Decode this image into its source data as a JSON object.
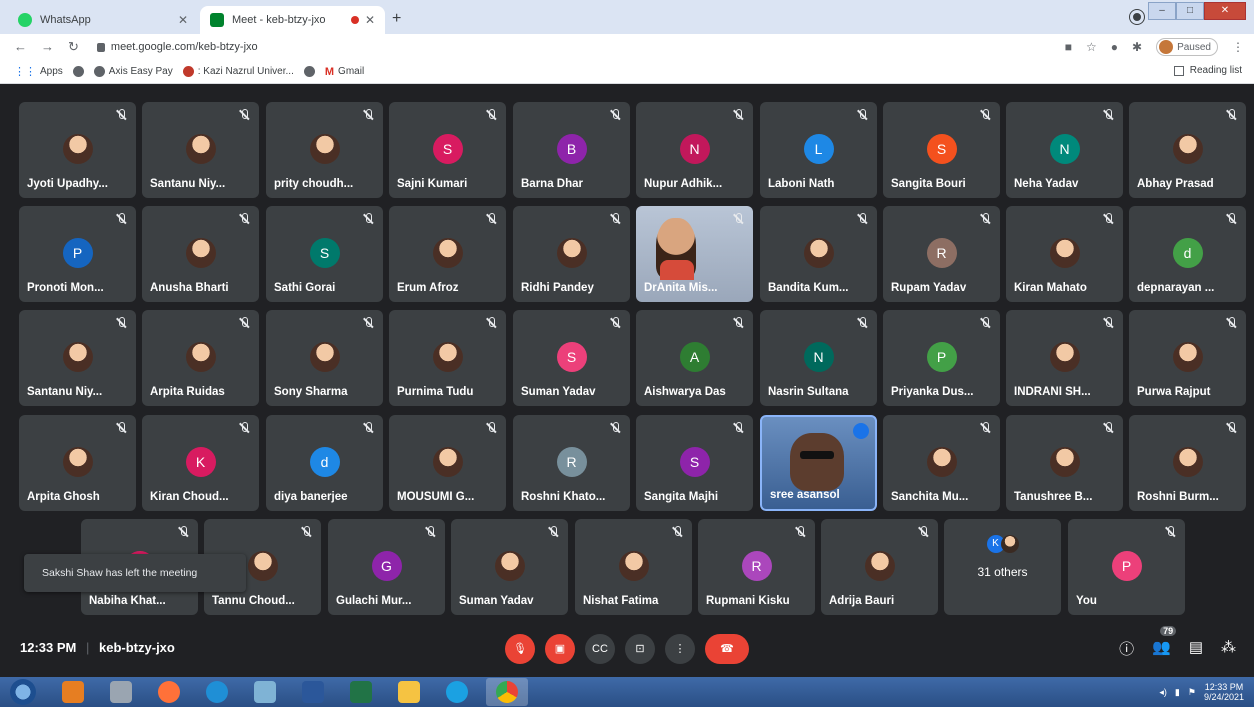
{
  "browser": {
    "tabs": [
      {
        "title": "WhatsApp",
        "favicon_color": "#25d366"
      },
      {
        "title": "Meet - keb-btzy-jxo",
        "favicon_color": "#00832d"
      }
    ],
    "url": "meet.google.com/keb-btzy-jxo",
    "profile_status": "Paused",
    "bookmarks": [
      {
        "label": "Apps"
      },
      {
        "label": "Axis Easy Pay"
      },
      {
        "label": ": Kazi Nazrul Univer..."
      },
      {
        "label": "Gmail"
      }
    ],
    "reading_list": "Reading list"
  },
  "meeting": {
    "toast": "Sakshi Shaw has left the meeting",
    "participants": [
      {
        "name": "Jyoti Upadhy...",
        "initial": "",
        "color": "",
        "kind": "photo"
      },
      {
        "name": "Santanu Niy...",
        "initial": "",
        "color": "",
        "kind": "photo"
      },
      {
        "name": "prity choudh...",
        "initial": "",
        "color": "",
        "kind": "photo"
      },
      {
        "name": "Sajni Kumari",
        "initial": "S",
        "color": "#d81b60",
        "kind": "letter"
      },
      {
        "name": "Barna Dhar",
        "initial": "B",
        "color": "#8e24aa",
        "kind": "letter"
      },
      {
        "name": "Nupur Adhik...",
        "initial": "N",
        "color": "#c2185b",
        "kind": "letter"
      },
      {
        "name": "Laboni Nath",
        "initial": "L",
        "color": "#1e88e5",
        "kind": "letter"
      },
      {
        "name": "Sangita Bouri",
        "initial": "S",
        "color": "#f4511e",
        "kind": "letter"
      },
      {
        "name": "Neha Yadav",
        "initial": "N",
        "color": "#00897b",
        "kind": "letter"
      },
      {
        "name": "Abhay Prasad",
        "initial": "",
        "color": "",
        "kind": "photo"
      },
      {
        "name": "Pronoti Mon...",
        "initial": "P",
        "color": "#1565c0",
        "kind": "letter"
      },
      {
        "name": "Anusha Bharti",
        "initial": "",
        "color": "",
        "kind": "photo"
      },
      {
        "name": "Sathi Gorai",
        "initial": "S",
        "color": "#00796b",
        "kind": "letter"
      },
      {
        "name": "Erum Afroz",
        "initial": "",
        "color": "",
        "kind": "photo"
      },
      {
        "name": "Ridhi Pandey",
        "initial": "",
        "color": "",
        "kind": "photo"
      },
      {
        "name": "DrAnita Mis...",
        "initial": "",
        "color": "",
        "kind": "video2"
      },
      {
        "name": "Bandita Kum...",
        "initial": "",
        "color": "",
        "kind": "photo"
      },
      {
        "name": "Rupam Yadav",
        "initial": "R",
        "color": "#8d6e63",
        "kind": "letter"
      },
      {
        "name": "Kiran Mahato",
        "initial": "",
        "color": "",
        "kind": "photo"
      },
      {
        "name": "depnarayan ...",
        "initial": "d",
        "color": "#43a047",
        "kind": "letter"
      },
      {
        "name": "Santanu Niy...",
        "initial": "",
        "color": "",
        "kind": "photo"
      },
      {
        "name": "Arpita Ruidas",
        "initial": "",
        "color": "",
        "kind": "photo"
      },
      {
        "name": "Sony Sharma",
        "initial": "",
        "color": "",
        "kind": "photo"
      },
      {
        "name": "Purnima Tudu",
        "initial": "",
        "color": "",
        "kind": "photo"
      },
      {
        "name": "Suman Yadav",
        "initial": "S",
        "color": "#ec407a",
        "kind": "letter"
      },
      {
        "name": "Aishwarya Das",
        "initial": "A",
        "color": "#2e7d32",
        "kind": "letter"
      },
      {
        "name": "Nasrin Sultana",
        "initial": "N",
        "color": "#00695c",
        "kind": "letter"
      },
      {
        "name": "Priyanka Dus...",
        "initial": "P",
        "color": "#43a047",
        "kind": "letter"
      },
      {
        "name": "INDRANI SH...",
        "initial": "",
        "color": "",
        "kind": "photo"
      },
      {
        "name": "Purwa Rajput",
        "initial": "",
        "color": "",
        "kind": "photo"
      },
      {
        "name": "Arpita Ghosh",
        "initial": "",
        "color": "",
        "kind": "photo"
      },
      {
        "name": "Kiran Choud...",
        "initial": "K",
        "color": "#d81b60",
        "kind": "letter"
      },
      {
        "name": "diya banerjee",
        "initial": "d",
        "color": "#1e88e5",
        "kind": "letter"
      },
      {
        "name": "MOUSUMI G...",
        "initial": "",
        "color": "",
        "kind": "photo"
      },
      {
        "name": "Roshni Khato...",
        "initial": "R",
        "color": "#78909c",
        "kind": "letter"
      },
      {
        "name": "Sangita Majhi",
        "initial": "S",
        "color": "#8e24aa",
        "kind": "letter"
      },
      {
        "name": "sree asansol",
        "initial": "",
        "color": "",
        "kind": "video"
      },
      {
        "name": "Sanchita Mu...",
        "initial": "",
        "color": "",
        "kind": "photo"
      },
      {
        "name": "Tanushree B...",
        "initial": "",
        "color": "",
        "kind": "photo"
      },
      {
        "name": "Roshni Burm...",
        "initial": "",
        "color": "",
        "kind": "photo"
      },
      {
        "name": "Nabiha Khat...",
        "initial": "",
        "color": "#d81b60",
        "kind": "letter"
      },
      {
        "name": "Tannu Choud...",
        "initial": "",
        "color": "",
        "kind": "photo"
      },
      {
        "name": "Gulachi Mur...",
        "initial": "G",
        "color": "#8e24aa",
        "kind": "letter"
      },
      {
        "name": "Suman Yadav",
        "initial": "",
        "color": "",
        "kind": "photo"
      },
      {
        "name": "Nishat Fatima",
        "initial": "",
        "color": "",
        "kind": "photo"
      },
      {
        "name": "Rupmani Kisku",
        "initial": "R",
        "color": "#ab47bc",
        "kind": "letter"
      },
      {
        "name": "Adrija Bauri",
        "initial": "",
        "color": "",
        "kind": "photo"
      },
      {
        "name": "31 others",
        "initial": "K",
        "color": "#1a73e8",
        "kind": "others"
      },
      {
        "name": "You",
        "initial": "P",
        "color": "#ec407a",
        "kind": "letter"
      }
    ]
  },
  "bottom": {
    "time": "12:33 PM",
    "meeting_code": "keb-btzy-jxo",
    "people_count": "79"
  },
  "taskbar": {
    "time": "12:33 PM",
    "date": "9/24/2021"
  }
}
